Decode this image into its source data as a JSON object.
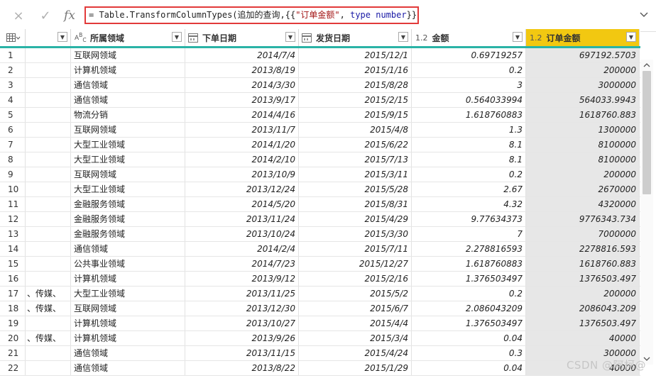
{
  "formula_bar": {
    "cancel_icon": "×",
    "confirm_icon": "✓",
    "fx_label": "fx",
    "formula_parts": {
      "p1": "= Table.TransformColumnTypes(追加的查询,{{",
      "p2": "\"订单金额\"",
      "p3": ", ",
      "p4": "type number",
      "p5": "}})"
    },
    "expand_icon": "chevron-down-icon"
  },
  "columns": {
    "domain": {
      "type_label": "A B C",
      "label": "所属领域"
    },
    "order_date": {
      "label": "下单日期"
    },
    "ship_date": {
      "label": "发货日期"
    },
    "amount": {
      "type_label": "1.2",
      "label": "金额"
    },
    "order_amount": {
      "type_label": "1.2",
      "label": "订单金额"
    }
  },
  "rows": [
    {
      "i": "1",
      "c1": "",
      "d": "互联网领域",
      "o": "2014/7/4",
      "s": "2015/12/1",
      "a": "0.69719257",
      "oa": "697192.5703"
    },
    {
      "i": "2",
      "c1": "",
      "d": "计算机领域",
      "o": "2013/8/19",
      "s": "2015/1/16",
      "a": "0.2",
      "oa": "200000"
    },
    {
      "i": "3",
      "c1": "",
      "d": "通信领域",
      "o": "2014/3/30",
      "s": "2015/8/28",
      "a": "3",
      "oa": "3000000"
    },
    {
      "i": "4",
      "c1": "",
      "d": "通信领域",
      "o": "2013/9/17",
      "s": "2015/2/15",
      "a": "0.564033994",
      "oa": "564033.9943"
    },
    {
      "i": "5",
      "c1": "",
      "d": "物流分销",
      "o": "2014/4/16",
      "s": "2015/9/15",
      "a": "1.618760883",
      "oa": "1618760.883"
    },
    {
      "i": "6",
      "c1": "",
      "d": "互联网领域",
      "o": "2013/11/7",
      "s": "2015/4/8",
      "a": "1.3",
      "oa": "1300000"
    },
    {
      "i": "7",
      "c1": "",
      "d": "大型工业领域",
      "o": "2014/1/20",
      "s": "2015/6/22",
      "a": "8.1",
      "oa": "8100000"
    },
    {
      "i": "8",
      "c1": "",
      "d": "大型工业领域",
      "o": "2014/2/10",
      "s": "2015/7/13",
      "a": "8.1",
      "oa": "8100000"
    },
    {
      "i": "9",
      "c1": "",
      "d": "互联网领域",
      "o": "2013/10/9",
      "s": "2015/3/11",
      "a": "0.2",
      "oa": "200000"
    },
    {
      "i": "10",
      "c1": "",
      "d": "大型工业领域",
      "o": "2013/12/24",
      "s": "2015/5/28",
      "a": "2.67",
      "oa": "2670000"
    },
    {
      "i": "11",
      "c1": "",
      "d": "金融服务领域",
      "o": "2014/5/20",
      "s": "2015/8/31",
      "a": "4.32",
      "oa": "4320000"
    },
    {
      "i": "12",
      "c1": "",
      "d": "金融服务领域",
      "o": "2013/11/24",
      "s": "2015/4/29",
      "a": "9.77634373",
      "oa": "9776343.734"
    },
    {
      "i": "13",
      "c1": "",
      "d": "金融服务领域",
      "o": "2013/10/24",
      "s": "2015/3/30",
      "a": "7",
      "oa": "7000000"
    },
    {
      "i": "14",
      "c1": "",
      "d": "通信领域",
      "o": "2014/2/4",
      "s": "2015/7/11",
      "a": "2.278816593",
      "oa": "2278816.593"
    },
    {
      "i": "15",
      "c1": "",
      "d": "公共事业领域",
      "o": "2014/7/23",
      "s": "2015/12/27",
      "a": "1.618760883",
      "oa": "1618760.883"
    },
    {
      "i": "16",
      "c1": "",
      "d": "计算机领域",
      "o": "2013/9/12",
      "s": "2015/2/16",
      "a": "1.376503497",
      "oa": "1376503.497"
    },
    {
      "i": "17",
      "c1": "、传媒、",
      "d": "大型工业领域",
      "o": "2013/11/25",
      "s": "2015/5/2",
      "a": "0.2",
      "oa": "200000"
    },
    {
      "i": "18",
      "c1": "、传媒、",
      "d": "互联网领域",
      "o": "2013/12/30",
      "s": "2015/6/7",
      "a": "2.086043209",
      "oa": "2086043.209"
    },
    {
      "i": "19",
      "c1": "",
      "d": "计算机领域",
      "o": "2013/10/27",
      "s": "2015/4/4",
      "a": "1.376503497",
      "oa": "1376503.497"
    },
    {
      "i": "20",
      "c1": "、传媒、",
      "d": "计算机领域",
      "o": "2013/9/26",
      "s": "2015/3/4",
      "a": "0.04",
      "oa": "40000"
    },
    {
      "i": "21",
      "c1": "",
      "d": "通信领域",
      "o": "2013/11/15",
      "s": "2015/4/24",
      "a": "0.3",
      "oa": "300000"
    },
    {
      "i": "22",
      "c1": "",
      "d": "通信领域",
      "o": "2013/8/22",
      "s": "2015/1/29",
      "a": "0.04",
      "oa": "40000"
    }
  ],
  "watermark": "CSDN @阿柯@",
  "colors": {
    "accent": "#2ab3a6",
    "selected_header": "#f2c811",
    "formula_border": "#e23a3a"
  }
}
